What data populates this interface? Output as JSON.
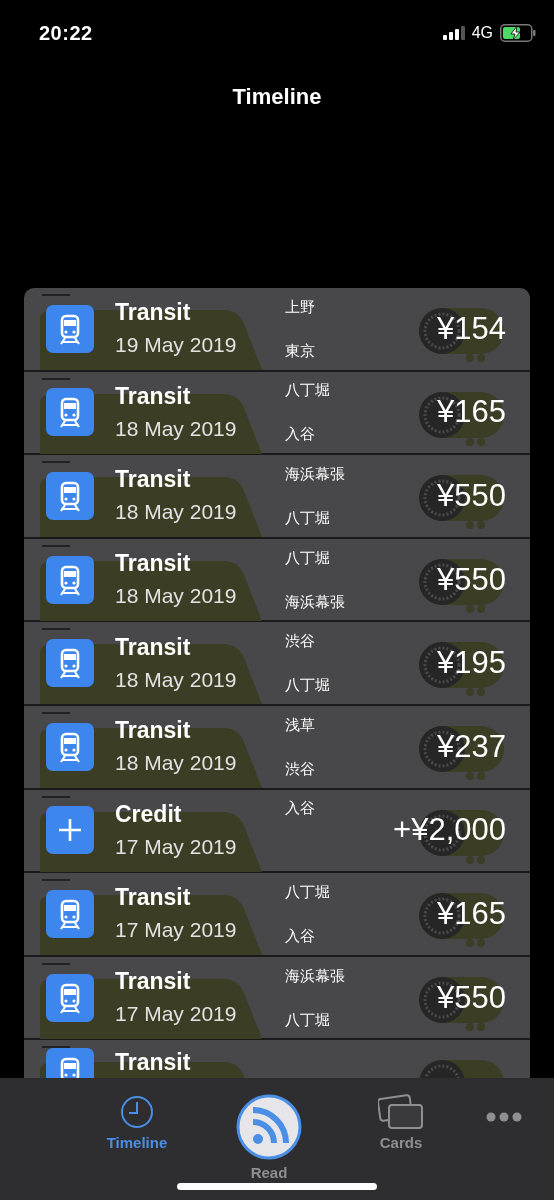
{
  "status_bar": {
    "time": "20:22",
    "network": "4G"
  },
  "nav": {
    "title": "Timeline"
  },
  "transactions": [
    {
      "kind": "transit",
      "type": "Transit",
      "date": "19 May 2019",
      "stations": [
        "上野",
        "東京"
      ],
      "amount": "¥154"
    },
    {
      "kind": "transit",
      "type": "Transit",
      "date": "18 May 2019",
      "stations": [
        "八丁堀",
        "入谷"
      ],
      "amount": "¥165"
    },
    {
      "kind": "transit",
      "type": "Transit",
      "date": "18 May 2019",
      "stations": [
        "海浜幕張",
        "八丁堀"
      ],
      "amount": "¥550"
    },
    {
      "kind": "transit",
      "type": "Transit",
      "date": "18 May 2019",
      "stations": [
        "八丁堀",
        "海浜幕張"
      ],
      "amount": "¥550"
    },
    {
      "kind": "transit",
      "type": "Transit",
      "date": "18 May 2019",
      "stations": [
        "渋谷",
        "八丁堀"
      ],
      "amount": "¥195"
    },
    {
      "kind": "transit",
      "type": "Transit",
      "date": "18 May 2019",
      "stations": [
        "浅草",
        "渋谷"
      ],
      "amount": "¥237"
    },
    {
      "kind": "credit",
      "type": "Credit",
      "date": "17 May 2019",
      "stations": [
        "入谷"
      ],
      "amount": "+¥2,000"
    },
    {
      "kind": "transit",
      "type": "Transit",
      "date": "17 May 2019",
      "stations": [
        "八丁堀",
        "入谷"
      ],
      "amount": "¥165"
    },
    {
      "kind": "transit",
      "type": "Transit",
      "date": "17 May 2019",
      "stations": [
        "海浜幕張",
        "八丁堀"
      ],
      "amount": "¥550"
    },
    {
      "kind": "transit",
      "type": "Transit"
    }
  ],
  "tab_bar": {
    "tabs": [
      {
        "kind": "timeline",
        "label": "Timeline",
        "selected": true
      },
      {
        "kind": "read",
        "label": "Read",
        "selected": false
      },
      {
        "kind": "cards",
        "label": "Cards",
        "selected": false
      }
    ]
  }
}
